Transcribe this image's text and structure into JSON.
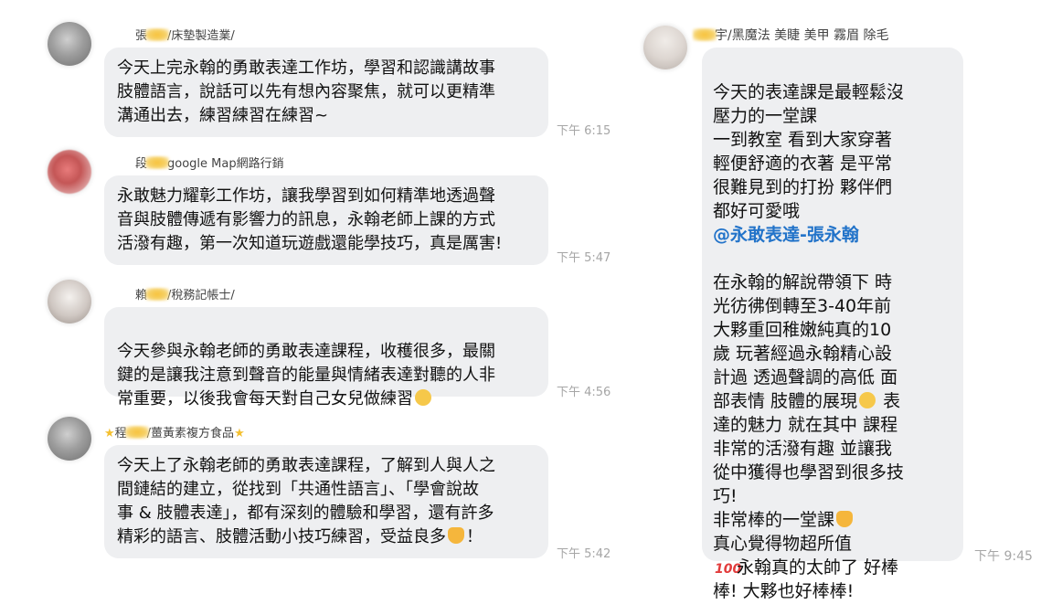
{
  "messages": [
    {
      "name_prefix": "張",
      "name_suffix": "/床墊製造業/",
      "text": "今天上完永翰的勇敢表達工作坊，學習和認識講故事\n肢體語言，說話可以先有想內容聚焦，就可以更精準\n溝通出去，練習練習在練習~",
      "time": "下午 6:15"
    },
    {
      "name_prefix": "段",
      "name_suffix": "google Map網路行銷",
      "text": "永敢魅力耀彰工作坊，讓我學習到如何精準地透過聲\n音與肢體傳遞有影響力的訊息，永翰老師上課的方式\n活潑有趣，第一次知道玩遊戲還能學技巧，真是厲害!",
      "time": "下午 5:47"
    },
    {
      "name_prefix": "賴",
      "name_suffix": "/稅務記帳士/",
      "text": "今天參與永翰老師的勇敢表達課程，收穫很多，最關\n鍵的是讓我注意到聲音的能量與情緒表達對聽的人非\n常重要，以後我會每天對自己女兒做練習",
      "time": "下午 4:56"
    },
    {
      "name_prefix": "程",
      "name_suffix": "/薑黃素複方食品",
      "text_lines": [
        "今天上了永翰老師的勇敢表達課程，了解到人與人之",
        "間鏈結的建立，從找到「共通性語言」、「學會說故",
        "事 & 肢體表達」，都有深刻的體驗和學習，還有許多",
        "精彩的語言、肢體活動小技巧練習，受益良多"
      ],
      "text_end": "！",
      "time": "下午 5:42"
    }
  ],
  "right_message": {
    "name_suffix": "宇/黑魔法 美睫 美甲 霧眉  除毛",
    "lines_a": "今天的表達課是最輕鬆沒\n壓力的一堂課\n一到教室 看到大家穿著\n輕便舒適的衣著 是平常\n很難見到的打扮 夥伴們\n都好可愛哦",
    "mention": "@永敢表達-張永翰",
    "lines_b": "在永翰的解說帶領下 時\n光彷彿倒轉至3-40年前\n大夥重回稚嫩純真的10\n歲 玩著經過永翰精心設\n計過 透過聲調的高低  面\n部表情 肢體的展現",
    "lines_c": " 表\n達的魅力 就在其中 課程\n非常的活潑有趣  並讓我\n從中獲得也學習到很多技\n巧!\n非常棒的一堂課",
    "line_d": "\n 真心覺得物超所值\n",
    "hundred": "100",
    "line_e": "永翰真的太帥了 好棒\n棒! 大夥也好棒棒!",
    "time": "下午 9:45"
  },
  "icons": [
    "avatar-photo",
    "grinning-emoji",
    "thumbs-up-emoji",
    "star-emoji",
    "hundred-points-emoji",
    "grimacing-emoji"
  ]
}
